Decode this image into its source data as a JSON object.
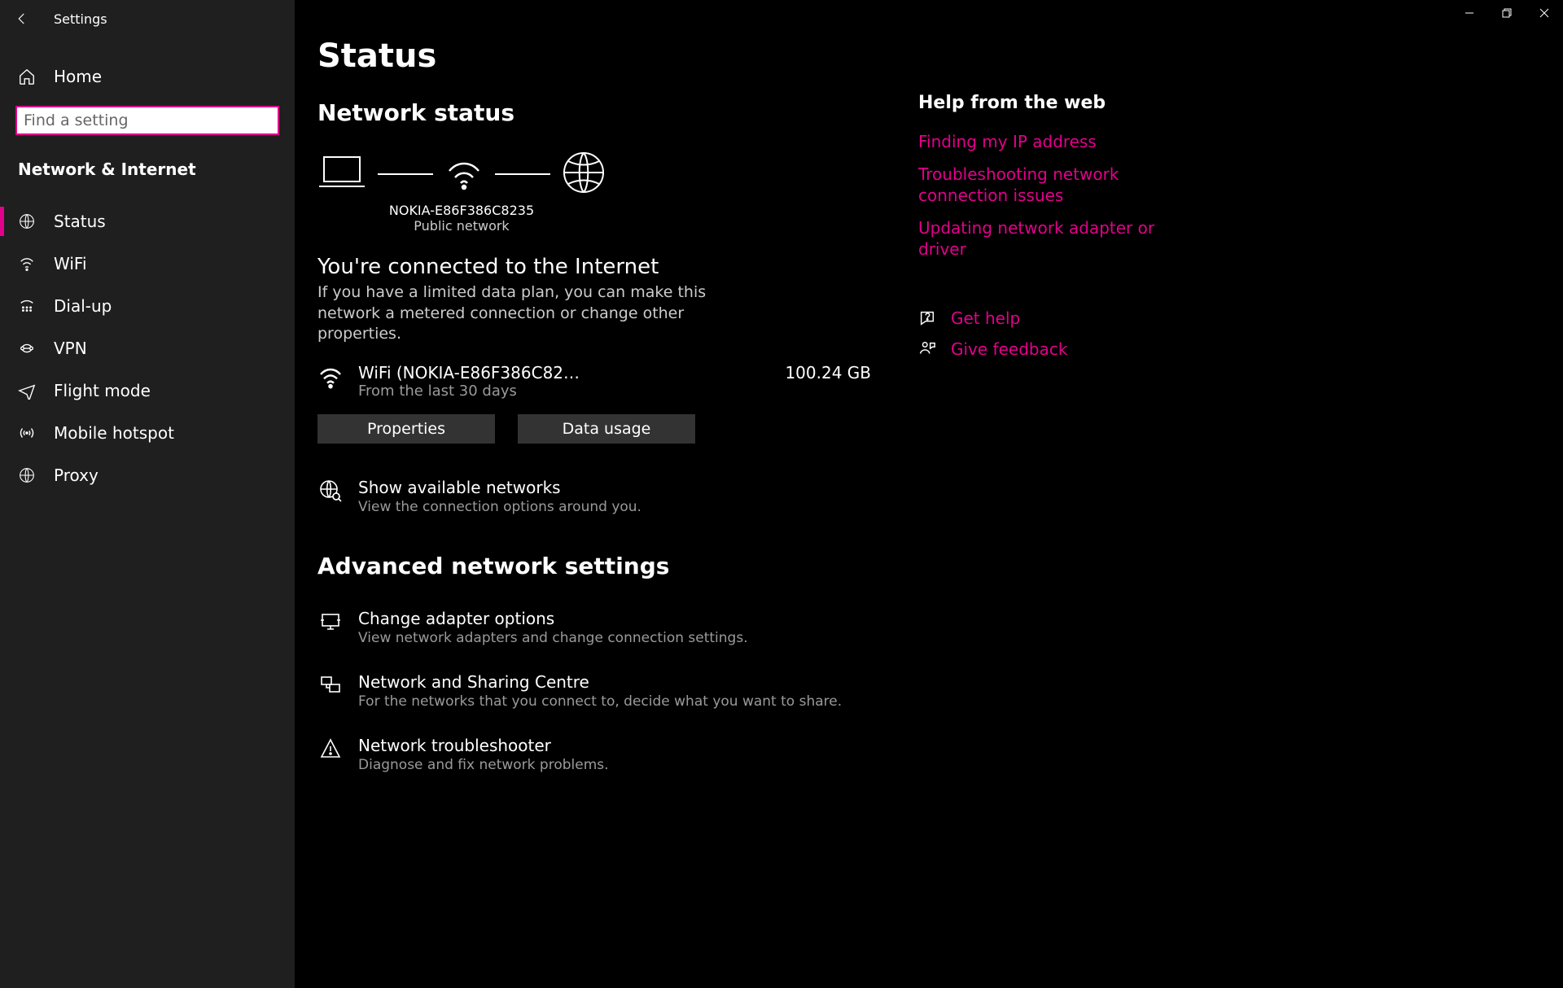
{
  "app_title": "Settings",
  "sidebar": {
    "home_label": "Home",
    "search_placeholder": "Find a setting",
    "category": "Network & Internet",
    "items": [
      {
        "label": "Status"
      },
      {
        "label": "WiFi"
      },
      {
        "label": "Dial-up"
      },
      {
        "label": "VPN"
      },
      {
        "label": "Flight mode"
      },
      {
        "label": "Mobile hotspot"
      },
      {
        "label": "Proxy"
      }
    ]
  },
  "page": {
    "title": "Status",
    "network_status_h": "Network status",
    "diagram": {
      "ssid": "NOKIA-E86F386C8235",
      "net_type": "Public network"
    },
    "connected_h": "You're connected to the Internet",
    "connected_sub": "If you have a limited data plan, you can make this network a metered connection or change other properties.",
    "network": {
      "name": "WiFi (NOKIA-E86F386C82…",
      "period": "From the last 30 days",
      "usage": "100.24 GB",
      "properties_btn": "Properties",
      "datausage_btn": "Data usage"
    },
    "show_networks": {
      "title": "Show available networks",
      "sub": "View the connection options around you."
    },
    "advanced_h": "Advanced network settings",
    "advanced": [
      {
        "title": "Change adapter options",
        "sub": "View network adapters and change connection settings."
      },
      {
        "title": "Network and Sharing Centre",
        "sub": "For the networks that you connect to, decide what you want to share."
      },
      {
        "title": "Network troubleshooter",
        "sub": "Diagnose and fix network problems."
      }
    ]
  },
  "help": {
    "heading": "Help from the web",
    "links": [
      "Finding my IP address",
      "Troubleshooting network connection issues",
      "Updating network adapter or driver"
    ],
    "get_help": "Get help",
    "give_feedback": "Give feedback"
  }
}
